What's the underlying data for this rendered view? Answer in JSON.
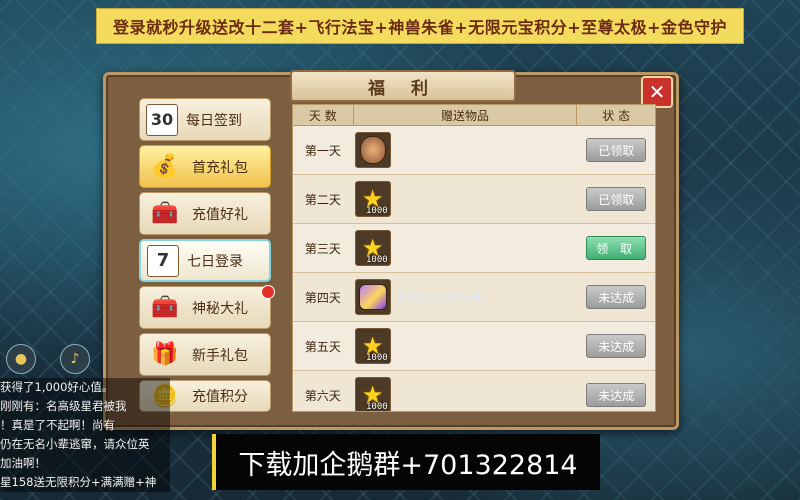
{
  "banner": "登录就秒升级送改十二套+飞行法宝+神兽朱雀+无限元宝积分+至尊太极+金色守护",
  "panel": {
    "title": "福 利",
    "close_label": "✕"
  },
  "menu": [
    {
      "label": "每日签到",
      "icon": "calendar-30-icon",
      "glyph": "30"
    },
    {
      "label": "首充礼包",
      "icon": "money-bag-icon",
      "glyph": "💰"
    },
    {
      "label": "充值好礼",
      "icon": "treasure-chest-icon",
      "glyph": "🧰"
    },
    {
      "label": "七日登录",
      "icon": "calendar-7-icon",
      "glyph": "7"
    },
    {
      "label": "神秘大礼",
      "icon": "gold-chest-icon",
      "glyph": "🧰"
    },
    {
      "label": "新手礼包",
      "icon": "gift-box-icon",
      "glyph": "🎁"
    },
    {
      "label": "充值积分",
      "icon": "gold-coins-icon",
      "glyph": "🪙"
    }
  ],
  "table": {
    "headers": [
      "天 数",
      "赠送物品",
      "状 态"
    ],
    "rows": [
      {
        "day": "第一天",
        "item": "monkey-king-icon",
        "qty": "",
        "status": "已领取",
        "state": "claimed"
      },
      {
        "day": "第二天",
        "item": "star-icon",
        "qty": "1000",
        "status": "已领取",
        "state": "claimed"
      },
      {
        "day": "第三天",
        "item": "star-icon",
        "qty": "1000",
        "status": "领 取",
        "state": "claim"
      },
      {
        "day": "第四天",
        "item": "gem-box-icon",
        "qty": "",
        "status": "未达成",
        "state": "locked",
        "overlay": "获得1,000好心值。"
      },
      {
        "day": "第五天",
        "item": "star-icon",
        "qty": "1000",
        "status": "未达成",
        "state": "locked"
      },
      {
        "day": "第六天",
        "item": "star-icon",
        "qty": "1000",
        "status": "未达成",
        "state": "locked"
      }
    ]
  },
  "chat": {
    "lines": [
      "获得了1,000好心值。",
      "刚刚有：名高级星君被我",
      "！真是了不起啊！尚有",
      "仍在无名小辈逃窜，请众位英",
      "加油啊！",
      "星158送无限积分+满满赠+神"
    ]
  },
  "join_text": "下载加企鹅群+701322814",
  "colors": {
    "banner_bg": "#f3dc5d",
    "claim_btn": "#3fae73",
    "close_btn": "#c8322b"
  }
}
